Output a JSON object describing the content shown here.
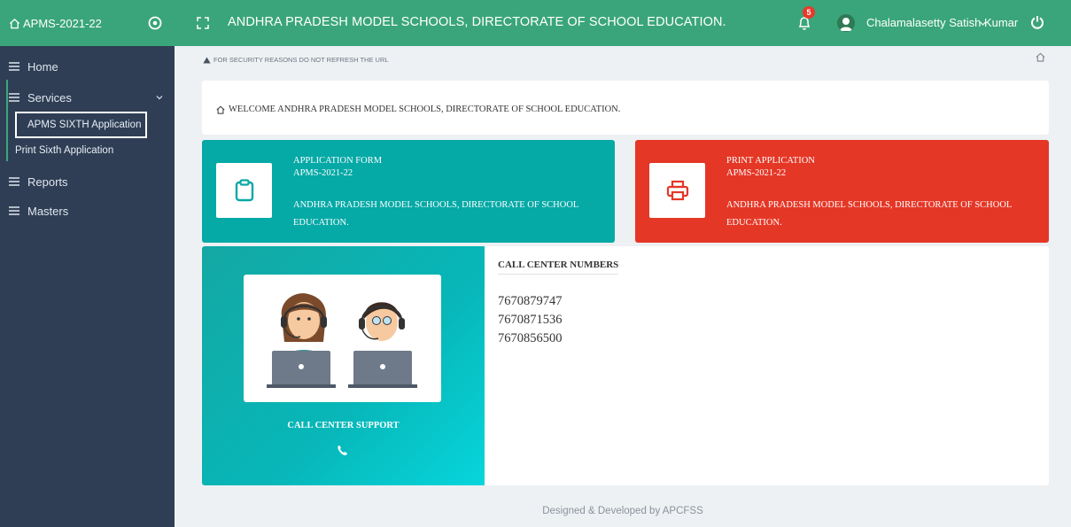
{
  "topbar": {
    "brand": "APMS-2021-22",
    "title": "ANDHRA PRADESH MODEL SCHOOLS, DIRECTORATE OF SCHOOL EDUCATION.",
    "notification_count": "5",
    "user_name": "Chalamalasetty Satish Kumar"
  },
  "sidebar": {
    "items": [
      {
        "label": "Home"
      },
      {
        "label": "Services"
      },
      {
        "label": "Reports"
      },
      {
        "label": "Masters"
      }
    ],
    "services_sub": [
      {
        "label": "APMS SIXTH Application"
      },
      {
        "label": "Print Sixth Application"
      }
    ]
  },
  "notice": "FOR SECURITY REASONS DO NOT REFRESH THE URL",
  "welcome": "WELCOME ANDHRA PRADESH MODEL SCHOOLS, DIRECTORATE OF SCHOOL EDUCATION.",
  "cards": [
    {
      "title": "APPLICATION FORM",
      "year": "APMS-2021-22",
      "org": "ANDHRA PRADESH MODEL SCHOOLS, DIRECTORATE OF SCHOOL EDUCATION.",
      "color": "#05a9a6"
    },
    {
      "title": "PRINT APPLICATION",
      "year": "APMS-2021-22",
      "org": "ANDHRA PRADESH MODEL SCHOOLS, DIRECTORATE OF SCHOOL EDUCATION.",
      "color": "#e53726"
    }
  ],
  "support": {
    "title": "CALL CENTER SUPPORT",
    "heading": "CALL CENTER NUMBERS",
    "numbers": [
      "7670879747",
      "7670871536",
      "7670856500"
    ]
  },
  "footer": "Designed & Developed by APCFSS",
  "colors": {
    "header": "#3aa57a",
    "sidebar": "#2f3e55",
    "teal": "#05a9a6",
    "red": "#e53726"
  }
}
